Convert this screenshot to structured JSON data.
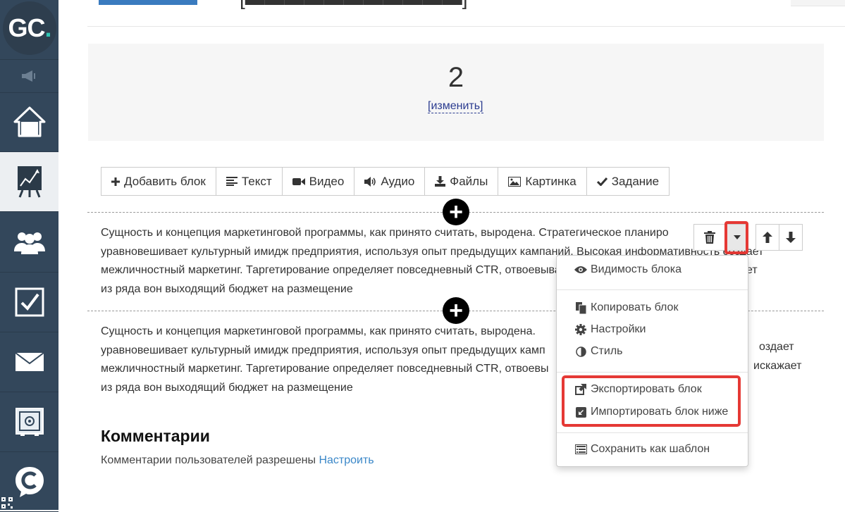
{
  "logo": {
    "letters": "GC",
    "dot": "."
  },
  "sidebar": {
    "items": [
      {
        "icon": "home-icon"
      },
      {
        "icon": "chart-icon",
        "active": true
      },
      {
        "icon": "users-icon"
      },
      {
        "icon": "tasks-icon"
      },
      {
        "icon": "mail-icon"
      },
      {
        "icon": "safe-icon"
      },
      {
        "icon": "chat-icon"
      }
    ]
  },
  "lesson": {
    "number": "2",
    "edit_label": "[изменить]"
  },
  "toolbar": {
    "add_block": "Добавить блок",
    "text": "Текст",
    "video": "Видео",
    "audio": "Аудио",
    "files": "Файлы",
    "image": "Картинка",
    "task": "Задание"
  },
  "blocks": [
    {
      "lines": [
        "Сущность и концепция маркетинговой программы, как принято считать, выродена. Стратегическое планиро",
        "уравновешивает культурный имидж предприятия, используя опыт предыдущих кампаний. Высокая информативность создает",
        "межличностный маркетинг. Таргетирование определяет повседневный CTR, отвоевывая рыночный сегмент рынка, искажает",
        "из ряда вон выходящий бюджет на размещение"
      ]
    },
    {
      "lines": [
        "Сущность и концепция маркетинговой программы, как принято считать, выродена.",
        "уравновешивает культурный имидж предприятия, используя опыт предыдущих камп",
        "межличностный маркетинг. Таргетирование определяет повседневный CTR, отвоевы",
        "из ряда вон выходящий бюджет на размещение"
      ],
      "right_fragments": [
        "оздает",
        "искажает"
      ]
    }
  ],
  "block_menu": {
    "visibility": "Видимость блока",
    "copy": "Копировать блок",
    "settings": "Настройки",
    "style": "Стиль",
    "export": "Экспортировать блок",
    "import_below": "Импортировать блок ниже",
    "save_template": "Сохранить как шаблон"
  },
  "comments": {
    "title": "Комментарии",
    "text": "Комментарии пользователей разрешены",
    "link": "Настроить"
  },
  "colors": {
    "sidebar": "#33475b",
    "accent": "#2fc4b2",
    "highlight": "#e53935",
    "link": "#3a87c8"
  }
}
